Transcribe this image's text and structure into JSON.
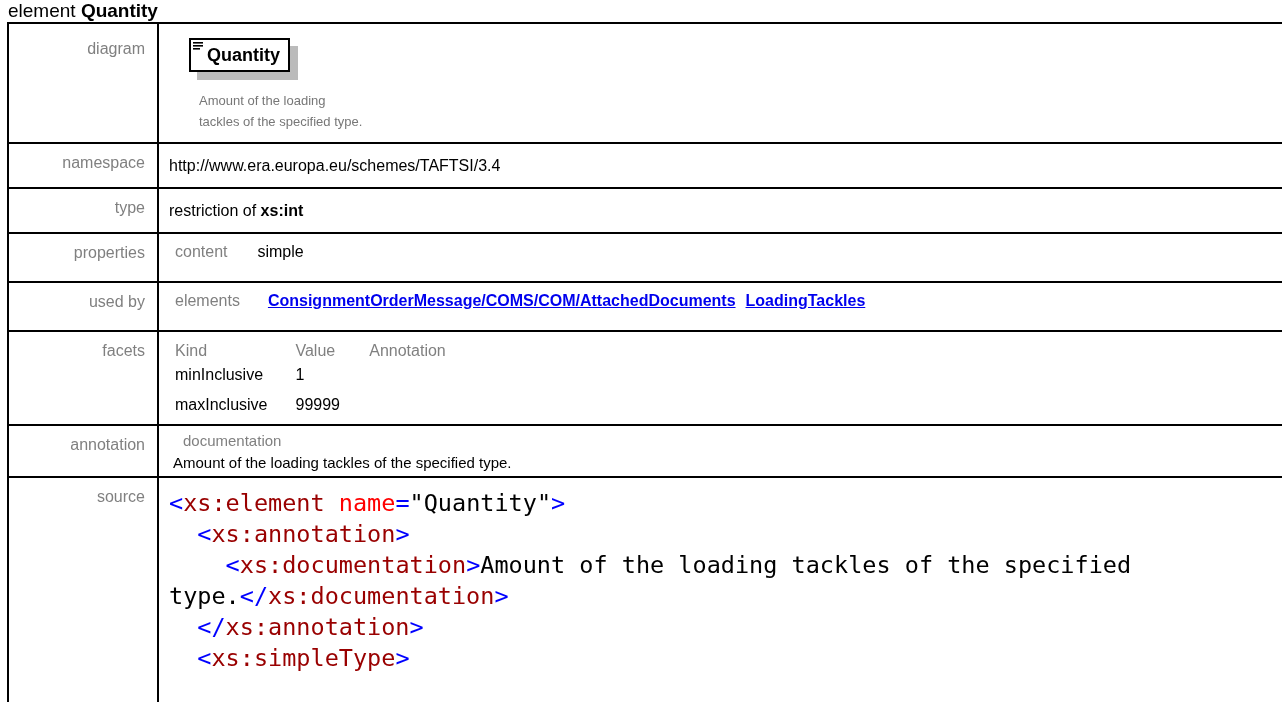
{
  "heading": {
    "kind_label": "element",
    "name": "Quantity"
  },
  "rows": [
    {
      "label": "diagram",
      "kind": "diagram",
      "box": "Quantity",
      "doc": [
        "Amount of the loading",
        "tackles of the specified type."
      ]
    },
    {
      "label": "namespace",
      "kind": "text",
      "text": "http://www.era.europa.eu/schemes/TAFTSI/3.4"
    },
    {
      "label": "type",
      "kind": "rich",
      "text": "restriction of **xs:int**"
    },
    {
      "label": "properties",
      "kind": "props",
      "key": "content",
      "value": "simple"
    },
    {
      "label": "used by",
      "kind": "links",
      "key": "elements",
      "links": [
        "ConsignmentOrderMessage/COMS/COM/AttachedDocuments",
        "LoadingTackles"
      ]
    },
    {
      "label": "facets",
      "kind": "facets",
      "columns": [
        "Kind",
        "Value",
        "Annotation"
      ],
      "items": [
        [
          "minInclusive",
          "1"
        ],
        [
          "maxInclusive",
          "99999"
        ]
      ]
    },
    {
      "label": "annotation",
      "kind": "annotation",
      "key": "documentation",
      "text": "Amount of the loading tackles of the specified type."
    },
    {
      "label": "source",
      "kind": "source",
      "lines": [
        [
          {
            "kind": "punct",
            "text": "<"
          },
          {
            "kind": "tag",
            "text": "xs:element"
          },
          {
            "kind": "attr",
            "text": " name"
          },
          {
            "kind": "punct",
            "text": "="
          },
          {
            "kind": "value",
            "text": "\"Quantity\""
          },
          {
            "kind": "punct",
            "text": ">"
          }
        ],
        [
          {
            "kind": "punct",
            "text": "  <"
          },
          {
            "kind": "tag",
            "text": "xs:annotation"
          },
          {
            "kind": "punct",
            "text": ">"
          }
        ],
        [
          {
            "kind": "punct",
            "text": "    <"
          },
          {
            "kind": "tag",
            "text": "xs:documentation"
          },
          {
            "kind": "punct",
            "text": ">"
          },
          {
            "kind": "value",
            "text": "Amount of the loading tackles of the specified"
          }
        ],
        [
          {
            "kind": "value",
            "text": "type."
          },
          {
            "kind": "punct",
            "text": "</"
          },
          {
            "kind": "tag",
            "text": "xs:documentation"
          },
          {
            "kind": "punct",
            "text": ">"
          }
        ],
        [
          {
            "kind": "punct",
            "text": "  </"
          },
          {
            "kind": "tag",
            "text": "xs:annotation"
          },
          {
            "kind": "punct",
            "text": ">"
          }
        ],
        [
          {
            "kind": "punct",
            "text": "  <"
          },
          {
            "kind": "tag",
            "text": "xs:simpleType"
          },
          {
            "kind": "punct",
            "text": ">"
          }
        ]
      ]
    }
  ]
}
